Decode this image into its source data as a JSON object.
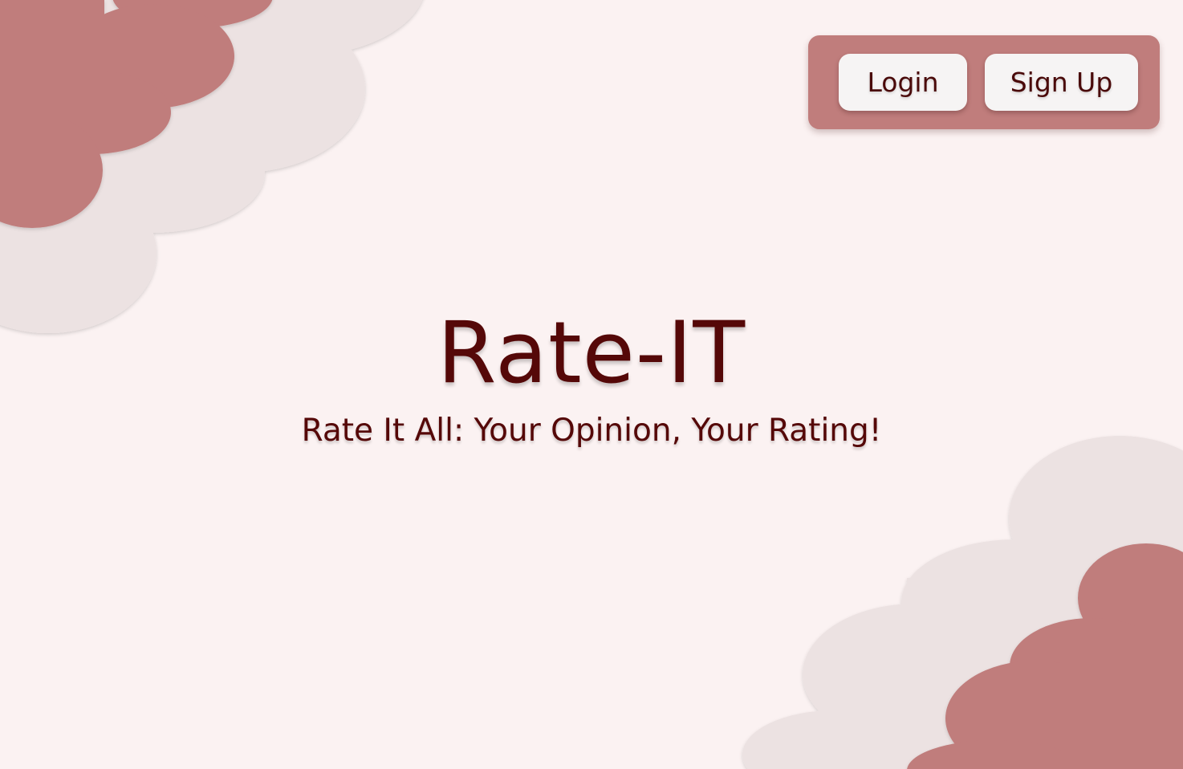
{
  "header": {
    "login_label": "Login",
    "signup_label": "Sign Up"
  },
  "hero": {
    "title": "Rate-IT",
    "subtitle": "Rate It All: Your Opinion, Your Rating!"
  },
  "colors": {
    "background": "#fbf2f2",
    "accent": "#c07d7c",
    "cloud_light": "#ece2e2",
    "text": "#550808",
    "button": "#f6f4f4"
  }
}
